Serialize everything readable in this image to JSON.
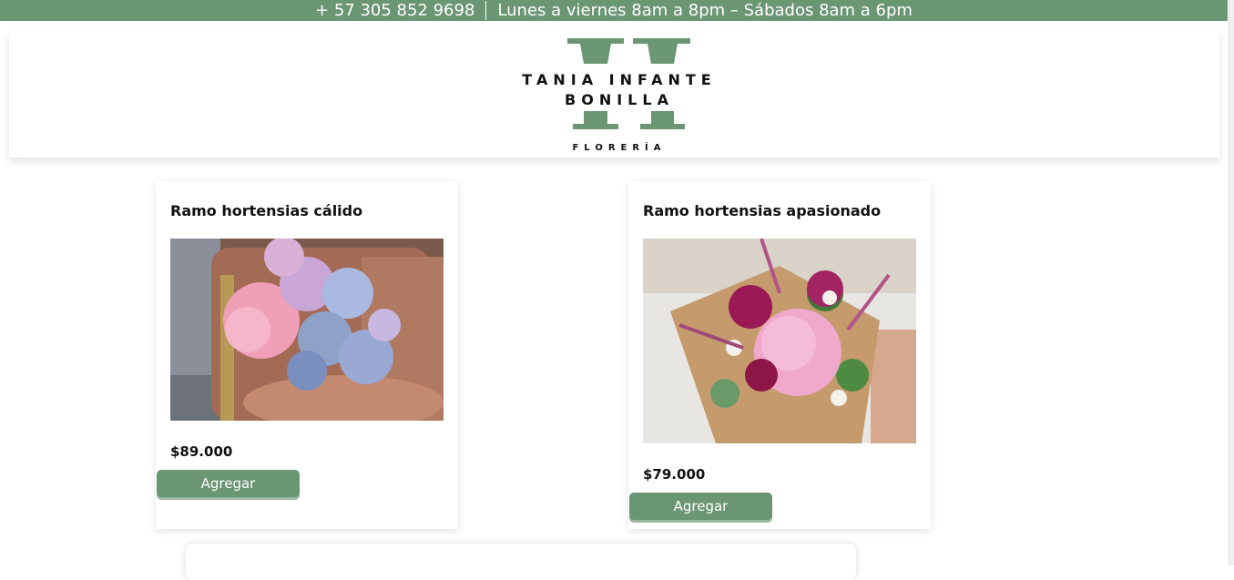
{
  "topbar": {
    "phone": "+ 57 305 852 9698",
    "hours": "Lunes a viernes 8am a 8pm – Sábados 8am a 6pm"
  },
  "logo": {
    "line1": "TANIA INFANTE",
    "line2": "BONILLA",
    "line3": "FLORERÍA"
  },
  "products": [
    {
      "title": "Ramo hortensias cálido",
      "price": "$89.000",
      "button": "Agregar",
      "image": "hydrangea-bouquet-pastel-on-chair"
    },
    {
      "title": "Ramo hortensias apasionado",
      "price": "$79.000",
      "button": "Agregar",
      "image": "hydrangea-bouquet-pink-magenta-kraft"
    }
  ],
  "colors": {
    "brand_green": "#6b9674"
  }
}
